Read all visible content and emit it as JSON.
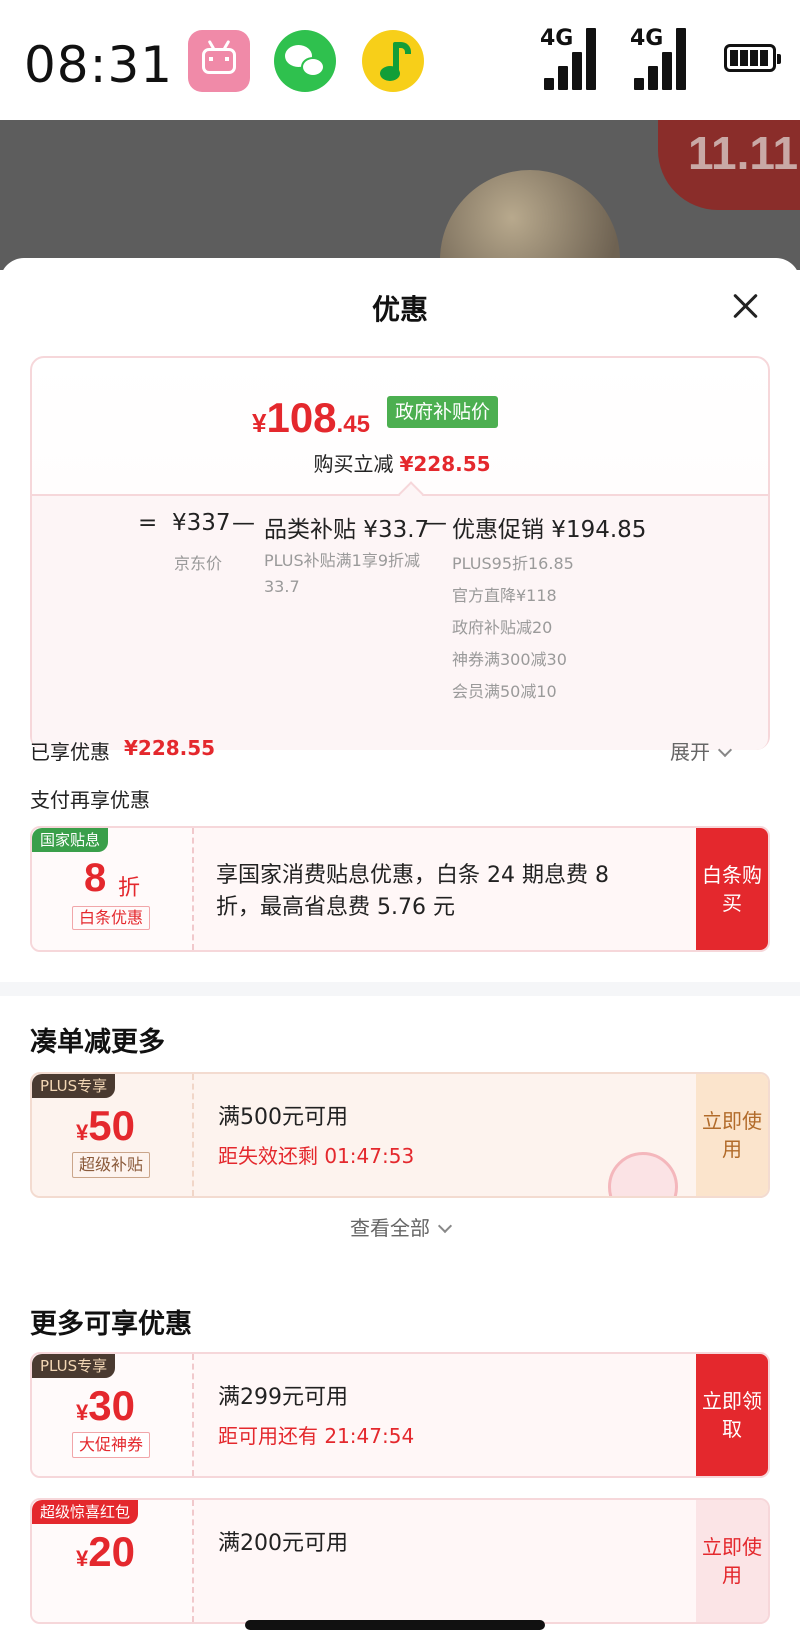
{
  "status_bar": {
    "time": "08:31",
    "apps": [
      "bilibili-icon",
      "wechat-icon",
      "qq-music-icon"
    ],
    "signal1_label": "4G",
    "signal2_label": "4G",
    "battery": "battery-icon"
  },
  "backdrop": {
    "promo_badge": "11.11"
  },
  "sheet": {
    "title": "优惠",
    "close_icon": "close-icon"
  },
  "price": {
    "currency": "¥",
    "integer": "108",
    "decimal": ".45",
    "tag": "政府补贴价",
    "reduce_label": "购买立减",
    "reduce_amount": "¥228.55",
    "formula": {
      "eq": "=",
      "base": "¥337",
      "minus1": "—",
      "category": "品类补贴 ¥33.7",
      "minus2": "—",
      "promo": "优惠促销 ¥194.85"
    },
    "base_label": "京东价",
    "category_detail": "PLUS补贴满1享9折减33.7",
    "promo_details": [
      "PLUS95折16.85",
      "官方直降¥118",
      "政府补贴减20",
      "神券满300减30",
      "会员满50减10"
    ]
  },
  "enjoyed": {
    "label": "已享优惠",
    "amount": "¥228.55",
    "expand": "展开"
  },
  "pay_again_title": "支付再享优惠",
  "baitiao": {
    "tag": "国家贴息",
    "discount": "8",
    "unit": "折",
    "label": "白条优惠",
    "description": "享国家消费贴息优惠，白条 24 期息费 8折，最高省息费 5.76 元",
    "action": "白条购买"
  },
  "combine": {
    "title": "凑单减更多",
    "coupon": {
      "tag": "PLUS专享",
      "currency": "¥",
      "amount": "50",
      "label": "超级补贴",
      "condition": "满500元可用",
      "expiry": "距失效还剩 01:47:53",
      "action": "立即使用"
    },
    "view_all": "查看全部"
  },
  "more": {
    "title": "更多可享优惠",
    "coupons": [
      {
        "tag": "PLUS专享",
        "currency": "¥",
        "amount": "30",
        "label": "大促神券",
        "condition": "满299元可用",
        "expiry": "距可用还有 21:47:54",
        "action": "立即领取"
      },
      {
        "tag": "超级惊喜红包",
        "currency": "¥",
        "amount": "20",
        "condition": "满200元可用",
        "action": "立即使用"
      }
    ]
  },
  "colors": {
    "accent_red": "#e4282d",
    "gov_green": "#4caf50",
    "plus_brown": "#4a3a30"
  }
}
